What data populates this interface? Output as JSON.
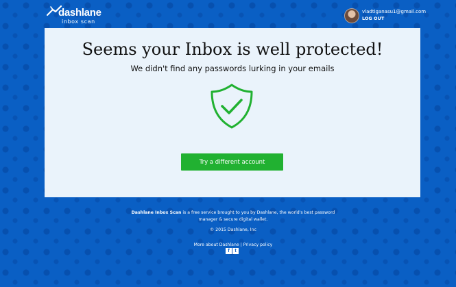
{
  "header": {
    "logo_name": "dashlane",
    "logo_sub": "inbox scan",
    "user_email": "vladtiganasu1@gmail.com",
    "logout_label": "LOG OUT"
  },
  "main": {
    "title": "Seems your Inbox is well protected!",
    "subtitle": "We didn't find any passwords lurking in your emails",
    "cta_label": "Try a different account"
  },
  "footer": {
    "brand": "Dashlane Inbox Scan",
    "description": " is a free service brought to you by Dashlane, the world's best password manager & secure digital wallet.",
    "copyright": "© 2015 Dashlane, Inc",
    "link_more": "More about Dashlane",
    "separator": "|",
    "link_privacy": "Privacy policy",
    "social_facebook": "f",
    "social_twitter": "t"
  },
  "colors": {
    "background": "#0a5fc4",
    "card": "#eaf3fb",
    "accent_green": "#21b131"
  },
  "icons": [
    "dashlane-logo-icon",
    "shield-check-icon",
    "facebook-icon",
    "twitter-icon"
  ]
}
